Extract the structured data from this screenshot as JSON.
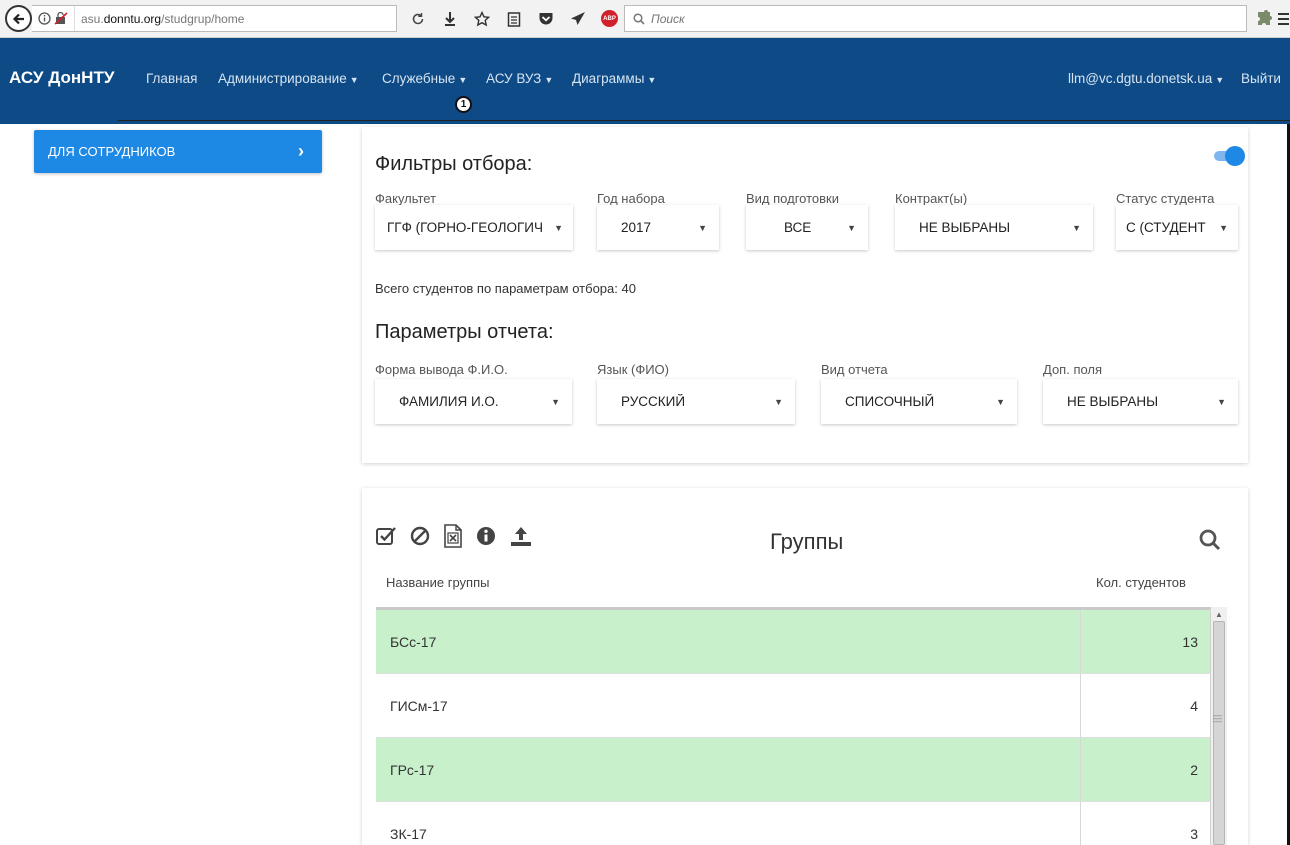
{
  "browser": {
    "url_domain": "asu.",
    "url_host": "donntu.org",
    "url_path": "/studgrup/home",
    "search_placeholder": "Поиск",
    "adblock_label": "ABP"
  },
  "navbar": {
    "brand": "АСУ ДонНТУ",
    "items": [
      {
        "label": "Главная"
      },
      {
        "label": "Администрирование"
      },
      {
        "label": "Служебные"
      },
      {
        "label": "АСУ ВУЗ"
      },
      {
        "label": "Диаграммы"
      }
    ],
    "badge": "1",
    "user": "llm@vc.dgtu.donetsk.ua",
    "logout": "Выйти"
  },
  "sidebar": {
    "staff_button": "ДЛЯ СОТРУДНИКОВ",
    "chevron": "›"
  },
  "filters": {
    "title": "Фильтры отбора:",
    "toggle_on": true,
    "fields": [
      {
        "label": "Факультет",
        "value": "ГГФ (ГОРНО-ГЕОЛОГИЧ"
      },
      {
        "label": "Год набора",
        "value": "2017"
      },
      {
        "label": "Вид подготовки",
        "value": "ВСЕ"
      },
      {
        "label": "Контракт(ы)",
        "value": "НЕ ВЫБРАНЫ"
      },
      {
        "label": "Статус студента",
        "value": "С (СТУДЕНТ"
      }
    ],
    "total_text": "Всего студентов по параметрам отбора: 40"
  },
  "report": {
    "title": "Параметры отчета:",
    "fields": [
      {
        "label": "Форма вывода Ф.И.О.",
        "value": "ФАМИЛИЯ И.О."
      },
      {
        "label": "Язык (ФИО)",
        "value": "РУССКИЙ"
      },
      {
        "label": "Вид отчета",
        "value": "СПИСОЧНЫЙ"
      },
      {
        "label": "Доп. поля",
        "value": "НЕ ВЫБРАНЫ"
      }
    ]
  },
  "groups": {
    "title": "Группы",
    "columns": {
      "name": "Название группы",
      "count": "Кол. студентов"
    },
    "rows": [
      {
        "name": "БСс-17",
        "count": "13"
      },
      {
        "name": "ГИСм-17",
        "count": "4"
      },
      {
        "name": "ГРс-17",
        "count": "2"
      },
      {
        "name": "ЗК-17",
        "count": "3"
      }
    ],
    "toolbar_icons": [
      "check-square-icon",
      "ban-icon",
      "excel-file-icon",
      "info-icon",
      "upload-icon"
    ]
  },
  "colors": {
    "navbar": "#0d4a86",
    "accent": "#1e88e5",
    "row_highlight": "#c7f0cb"
  }
}
